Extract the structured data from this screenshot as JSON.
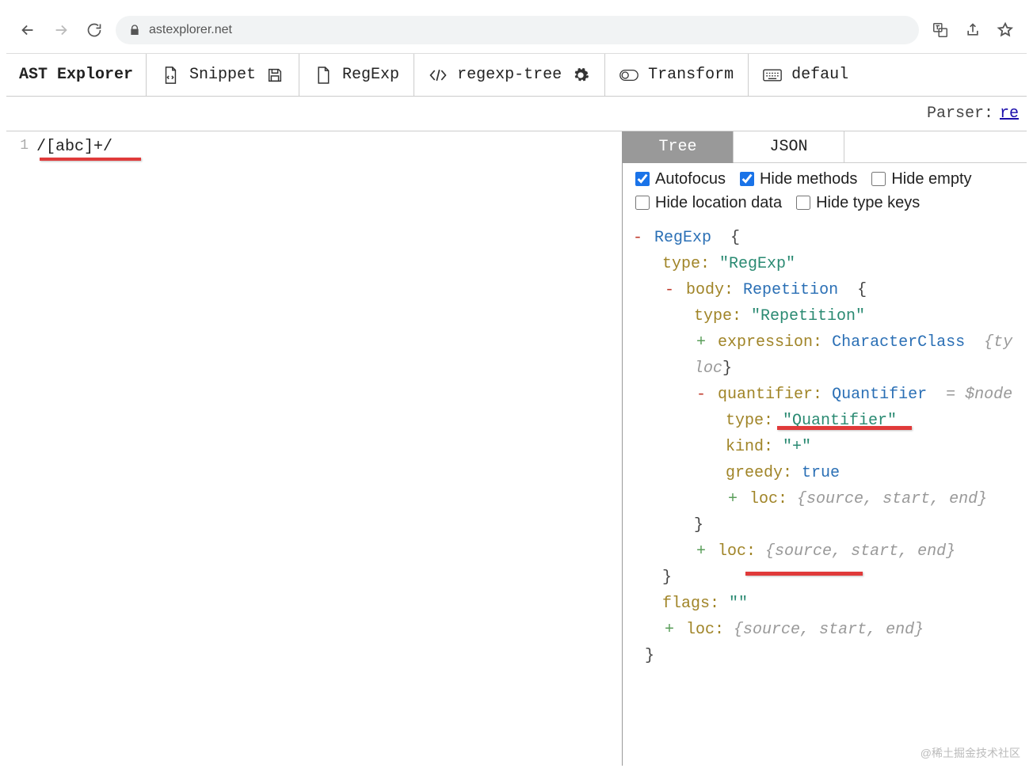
{
  "browser": {
    "url_domain": "astexplorer.net"
  },
  "toolbar": {
    "title": "AST Explorer",
    "snippet": "Snippet",
    "lang": "RegExp",
    "parser": "regexp-tree",
    "transform": "Transform",
    "keymap": "defaul"
  },
  "parser_line": {
    "label": "Parser:",
    "link": "re"
  },
  "editor": {
    "line_no": "1",
    "code": "/[abc]+/"
  },
  "tabs": {
    "tree": "Tree",
    "json": "JSON"
  },
  "options": {
    "autofocus": "Autofocus",
    "hide_methods": "Hide methods",
    "hide_empty": "Hide empty",
    "hide_location": "Hide location data",
    "hide_type": "Hide type keys"
  },
  "ast": {
    "root": "RegExp",
    "root_type_key": "type:",
    "root_type_val": "\"RegExp\"",
    "body_key": "body:",
    "body_node": "Repetition",
    "body_type_key": "type:",
    "body_type_val": "\"Repetition\"",
    "expr_key": "expression:",
    "expr_node": "CharacterClass",
    "expr_hint": "{ty",
    "expr_loc_hint": "loc",
    "quant_key": "quantifier:",
    "quant_node": "Quantifier",
    "quant_note": "= $node",
    "quant_type_key": "type:",
    "quant_type_val": "\"Quantifier\"",
    "quant_kind_key": "kind:",
    "quant_kind_val": "\"+\"",
    "quant_greedy_key": "greedy:",
    "quant_greedy_val": "true",
    "quant_loc_key": "loc:",
    "loc_hint": "{source, start, end}",
    "body_loc_key": "loc:",
    "flags_key": "flags:",
    "flags_val": "\"\"",
    "root_loc_key": "loc:",
    "brace_open": "{",
    "brace_close": "}"
  },
  "watermark": "@稀土掘金技术社区",
  "chart_data": null
}
